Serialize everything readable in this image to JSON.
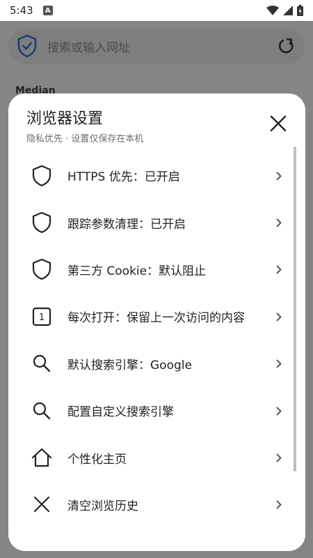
{
  "status_bar": {
    "time": "5:43",
    "notification_icon": "A"
  },
  "background": {
    "search_placeholder": "搜索或输入网址",
    "section_label": "Median"
  },
  "sheet": {
    "title": "浏览器设置",
    "subtitle": "隐私优先 · 设置仅保存在本机",
    "items": [
      {
        "icon": "shield-icon",
        "label": "HTTPS 优先：已开启"
      },
      {
        "icon": "shield-icon",
        "label": "跟踪参数清理：已开启"
      },
      {
        "icon": "shield-icon",
        "label": "第三方 Cookie：默认阻止"
      },
      {
        "icon": "number-box-icon",
        "icon_text": "1",
        "label": "每次打开：保留上一次访问的内容"
      },
      {
        "icon": "search-icon",
        "label": "默认搜索引擎：Google"
      },
      {
        "icon": "search-icon",
        "label": "配置自定义搜索引擎"
      },
      {
        "icon": "home-icon",
        "label": "个性化主页"
      },
      {
        "icon": "close-icon",
        "label": "清空浏览历史"
      }
    ]
  },
  "colors": {
    "accent": "#2a6fdb",
    "scrim": "#000000",
    "sheet_background": "#ffffff"
  }
}
